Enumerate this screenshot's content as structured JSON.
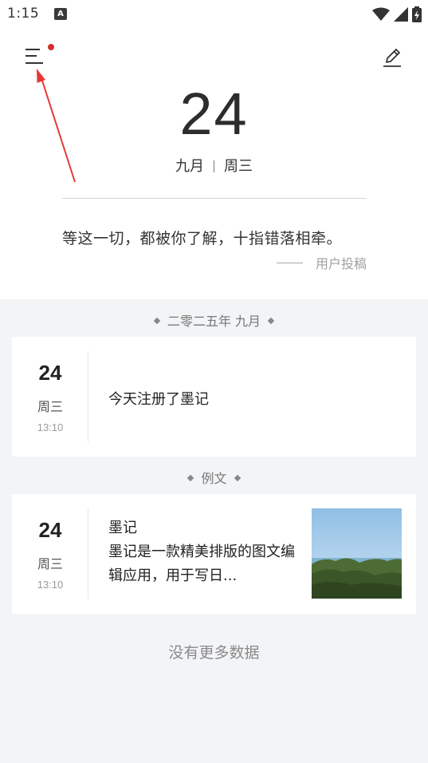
{
  "status_bar": {
    "time": "1:15",
    "notification_icon": "A"
  },
  "header": {
    "menu_icon": "menu-icon",
    "edit_icon": "pencil-icon",
    "day": "24",
    "month": "九月",
    "weekday": "周三",
    "quote": "等这一切，都被你了解，十指错落相牵。",
    "quote_author": "用户投稿",
    "badge_color": "#d32f2f",
    "annotation_color": "#e53935"
  },
  "groups": [
    {
      "label": "二零二五年 九月",
      "entries": [
        {
          "day": "24",
          "weekday": "周三",
          "time": "13:10",
          "text": "今天注册了墨记"
        }
      ]
    },
    {
      "label": "例文",
      "entries": [
        {
          "day": "24",
          "weekday": "周三",
          "time": "13:10",
          "title": "墨记",
          "excerpt": "墨记是一款精美排版的图文编辑应用，用于写日..."
        }
      ]
    }
  ],
  "footer": {
    "no_more": "没有更多数据"
  }
}
